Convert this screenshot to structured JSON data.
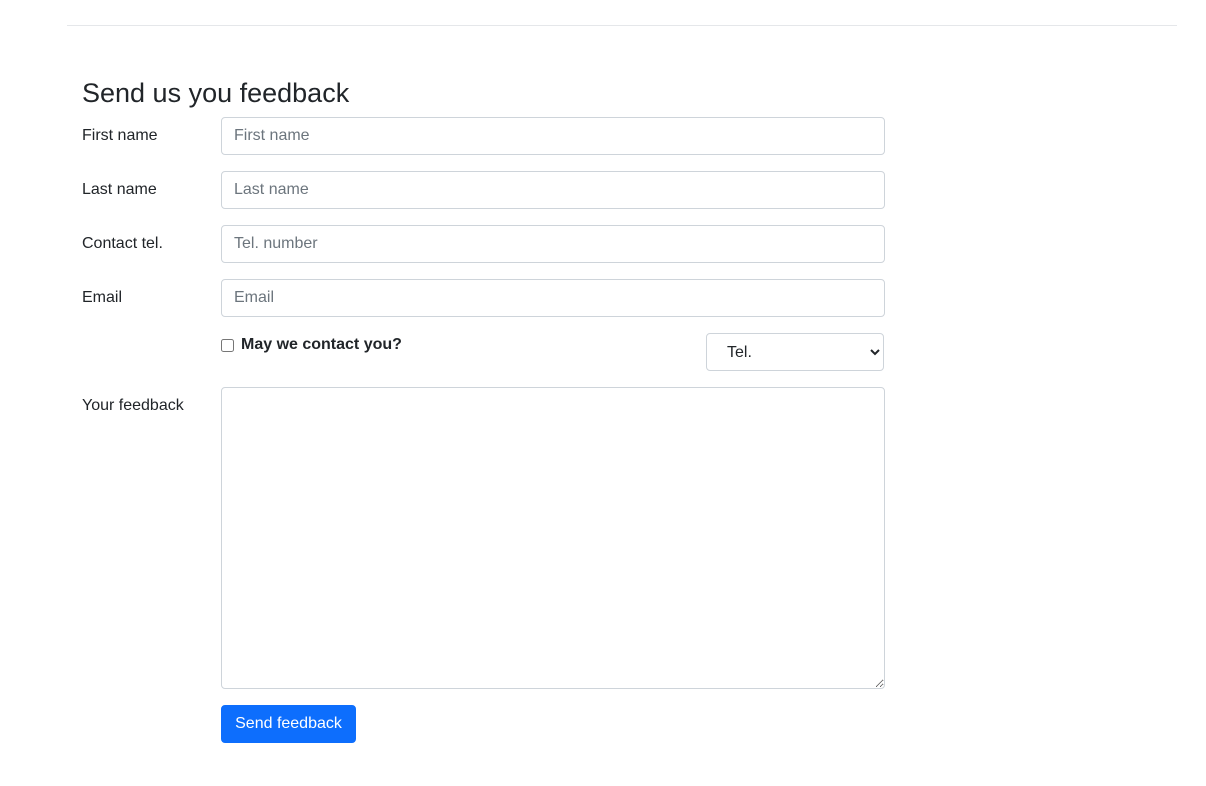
{
  "form": {
    "title": "Send us you feedback",
    "fields": {
      "first_name": {
        "label": "First name",
        "placeholder": "First name",
        "value": ""
      },
      "last_name": {
        "label": "Last name",
        "placeholder": "Last name",
        "value": ""
      },
      "contact_tel": {
        "label": "Contact tel.",
        "placeholder": "Tel. number",
        "value": ""
      },
      "email": {
        "label": "Email",
        "placeholder": "Email",
        "value": ""
      },
      "feedback": {
        "label": "Your feedback",
        "value": ""
      }
    },
    "contact_checkbox": {
      "label": "May we contact you?",
      "checked": false
    },
    "contact_method": {
      "selected": "Tel.",
      "options": [
        "Tel."
      ]
    },
    "submit_label": "Send feedback"
  },
  "colors": {
    "primary": "#0d6efd",
    "text": "#212529",
    "placeholder": "#6c757d",
    "border": "#ced4da"
  }
}
